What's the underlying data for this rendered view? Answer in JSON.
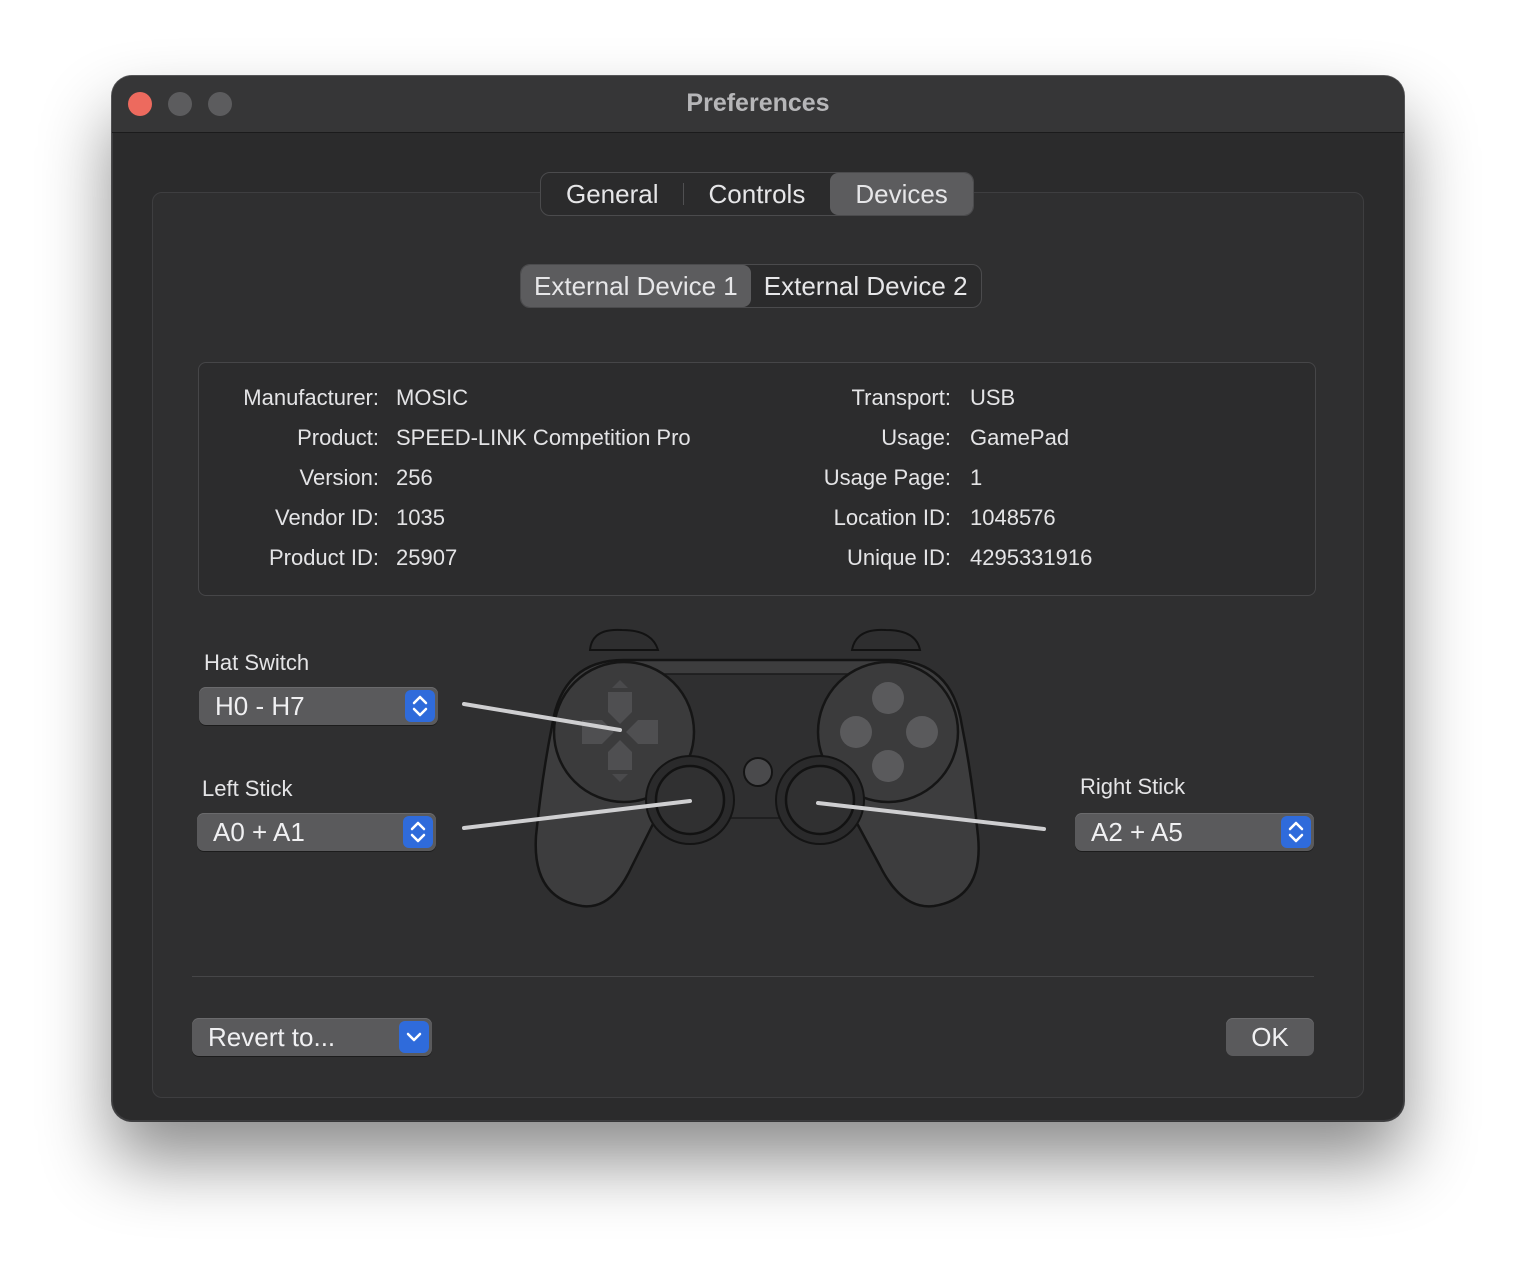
{
  "window": {
    "title": "Preferences"
  },
  "tabs": [
    {
      "label": "General"
    },
    {
      "label": "Controls"
    },
    {
      "label": "Devices",
      "selected": true
    }
  ],
  "device_tabs": [
    {
      "label": "External Device 1",
      "selected": true
    },
    {
      "label": "External Device 2"
    }
  ],
  "info": {
    "left": [
      {
        "label": "Manufacturer:",
        "value": "MOSIC"
      },
      {
        "label": "Product:",
        "value": "SPEED-LINK Competition Pro"
      },
      {
        "label": "Version:",
        "value": "256"
      },
      {
        "label": "Vendor ID:",
        "value": "1035"
      },
      {
        "label": "Product ID:",
        "value": "25907"
      }
    ],
    "right": [
      {
        "label": "Transport:",
        "value": "USB"
      },
      {
        "label": "Usage:",
        "value": "GamePad"
      },
      {
        "label": "Usage Page:",
        "value": "1"
      },
      {
        "label": "Location ID:",
        "value": "1048576"
      },
      {
        "label": "Unique ID:",
        "value": "4295331916"
      }
    ]
  },
  "mapping": {
    "hat_switch": {
      "label": "Hat Switch",
      "value": "H0 - H7"
    },
    "left_stick": {
      "label": "Left Stick",
      "value": "A0 + A1"
    },
    "right_stick": {
      "label": "Right Stick",
      "value": "A2 + A5"
    }
  },
  "footer": {
    "revert_label": "Revert to...",
    "ok_label": "OK"
  },
  "colors": {
    "close": "#ed6a5e",
    "accent": "#2f6bdb",
    "window_bg": "#2b2b2c"
  }
}
